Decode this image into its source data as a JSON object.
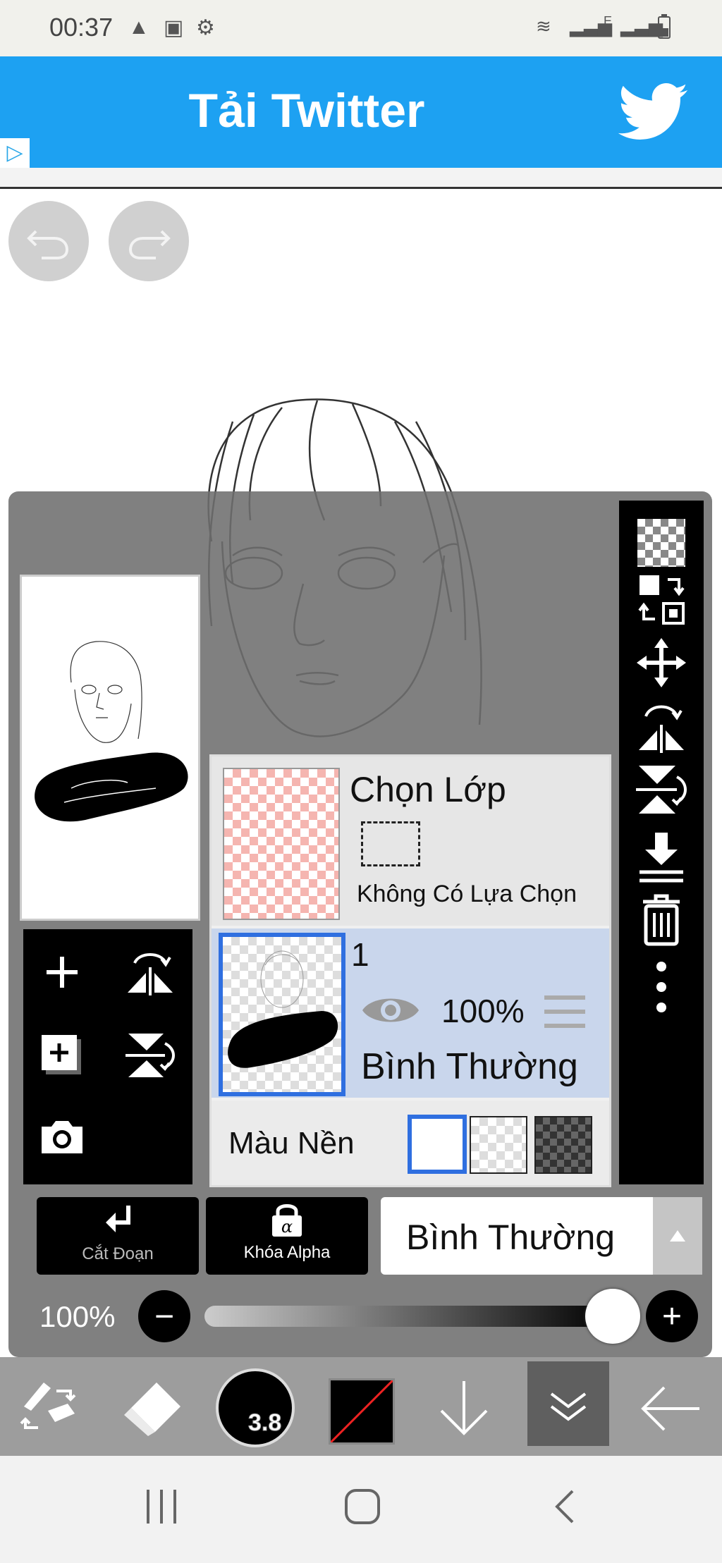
{
  "status_bar": {
    "time": "00:37",
    "notif_icons": [
      "warning-icon",
      "sim-icon",
      "gear-icon"
    ],
    "right_icons": [
      "wifi-icon",
      "signal-icon",
      "data-e-icon",
      "signal-icon",
      "battery-icon"
    ],
    "network_label": "E"
  },
  "ad": {
    "title": "Tải Twitter",
    "brand_color": "#1da1f2",
    "icon": "twitter-bird-icon"
  },
  "history": {
    "undo_icon": "undo-icon",
    "redo_icon": "redo-icon"
  },
  "right_tools": [
    "checkerboard-icon",
    "swap-layer-icon",
    "move-icon",
    "flip-horizontal-icon",
    "flip-vertical-icon",
    "merge-down-icon",
    "trash-icon",
    "more-icon"
  ],
  "left_tools": [
    "add-layer-icon",
    "flip-layer-icon",
    "add-copy-layer-icon",
    "rotate-layer-icon",
    "camera-icon"
  ],
  "layers": {
    "selection_layer": {
      "title": "Chọn Lớp",
      "status": "Không Có Lựa Chọn"
    },
    "layer_1": {
      "name": "1",
      "opacity": "100%",
      "blend_mode": "Bình Thường",
      "selected": true
    },
    "background": {
      "label": "Màu Nền",
      "options": [
        "white",
        "transparent",
        "dark-checker"
      ],
      "selected": "white"
    }
  },
  "actions": {
    "clipping_label": "Cắt Đoạn",
    "alpha_lock_label": "Khóa Alpha",
    "blend_mode_value": "Bình Thường"
  },
  "opacity": {
    "value_label": "100%",
    "value": 1.0
  },
  "brush": {
    "size": "3.8"
  },
  "accent_color": "#2f6fe0"
}
